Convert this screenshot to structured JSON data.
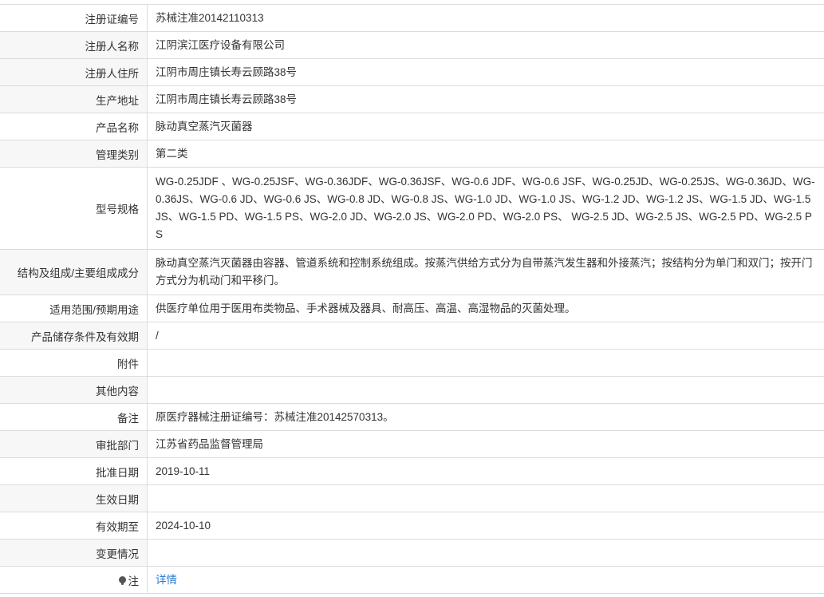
{
  "rows": [
    {
      "label": "注册证编号",
      "value": "苏械注准20142110313"
    },
    {
      "label": "注册人名称",
      "value": "江阴滨江医疗设备有限公司"
    },
    {
      "label": "注册人住所",
      "value": "江阴市周庄镇长寿云顾路38号"
    },
    {
      "label": "生产地址",
      "value": "江阴市周庄镇长寿云顾路38号"
    },
    {
      "label": "产品名称",
      "value": "脉动真空蒸汽灭菌器"
    },
    {
      "label": "管理类别",
      "value": "第二类"
    },
    {
      "label": "型号规格",
      "value": "WG-0.25JDF 、WG-0.25JSF、WG-0.36JDF、WG-0.36JSF、WG-0.6 JDF、WG-0.6 JSF、WG-0.25JD、WG-0.25JS、WG-0.36JD、WG-0.36JS、WG-0.6 JD、WG-0.6 JS、WG-0.8 JD、WG-0.8 JS、WG-1.0 JD、WG-1.0 JS、WG-1.2 JD、WG-1.2 JS、WG-1.5 JD、WG-1.5 JS、WG-1.5 PD、WG-1.5 PS、WG-2.0 JD、WG-2.0 JS、WG-2.0 PD、WG-2.0 PS、 WG-2.5 JD、WG-2.5 JS、WG-2.5 PD、WG-2.5 PS"
    },
    {
      "label": "结构及组成/主要组成成分",
      "value": "脉动真空蒸汽灭菌器由容器、管道系统和控制系统组成。按蒸汽供给方式分为自带蒸汽发生器和外接蒸汽；按结构分为单门和双门；按开门方式分为机动门和平移门。"
    },
    {
      "label": "适用范围/预期用途",
      "value": "供医疗单位用于医用布类物品、手术器械及器具、耐高压、高温、高湿物品的灭菌处理。"
    },
    {
      "label": "产品储存条件及有效期",
      "value": "/"
    },
    {
      "label": "附件",
      "value": ""
    },
    {
      "label": "其他内容",
      "value": ""
    },
    {
      "label": "备注",
      "value": "原医疗器械注册证编号：苏械注准20142570313。"
    },
    {
      "label": "审批部门",
      "value": "江苏省药品监督管理局"
    },
    {
      "label": "批准日期",
      "value": "2019-10-11"
    },
    {
      "label": "生效日期",
      "value": ""
    },
    {
      "label": "有效期至",
      "value": "2024-10-10"
    },
    {
      "label": "变更情况",
      "value": ""
    },
    {
      "label": "注",
      "value": "详情",
      "icon": "location-pin-icon"
    }
  ],
  "colors": {
    "border": "#dcdcdc",
    "alt_row": "#f7f7f7",
    "link": "#2a7ccf"
  }
}
